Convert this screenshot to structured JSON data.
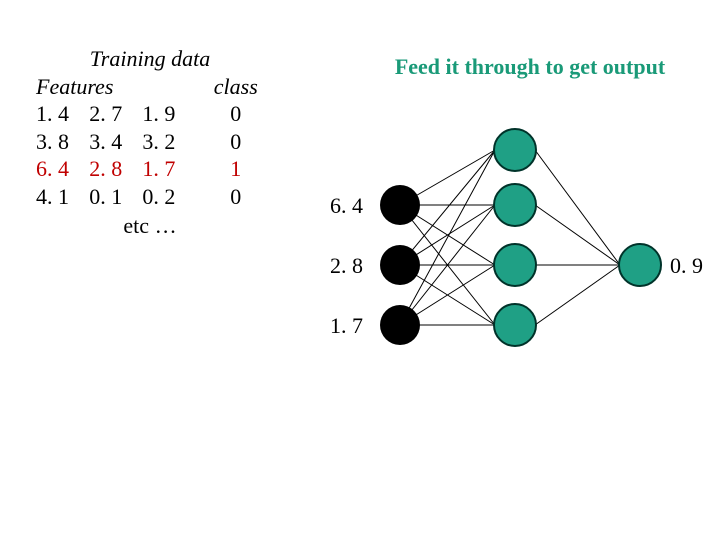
{
  "training": {
    "title": "Training data",
    "features_header": "Features",
    "class_header": "class",
    "rows": [
      {
        "f1": "1. 4",
        "f2": "2. 7",
        "f3": "1. 9",
        "cls": "0",
        "hl": false
      },
      {
        "f1": "3. 8",
        "f2": "3. 4",
        "f3": "3. 2",
        "cls": "0",
        "hl": false
      },
      {
        "f1": "6. 4",
        "f2": "2. 8",
        "f3": "1. 7",
        "cls": "1",
        "hl": true
      },
      {
        "f1": "4. 1",
        "f2": "0. 1",
        "f3": "0. 2",
        "cls": "0",
        "hl": false
      }
    ],
    "etc": "etc …"
  },
  "caption": "Feed it through to get output",
  "nn": {
    "inputs": [
      "6. 4",
      "2. 8",
      "1. 7"
    ],
    "output_value": "0. 9"
  },
  "colors": {
    "accent": "#1a9a78",
    "node_green": "#1fa085",
    "highlight": "#c00000"
  }
}
